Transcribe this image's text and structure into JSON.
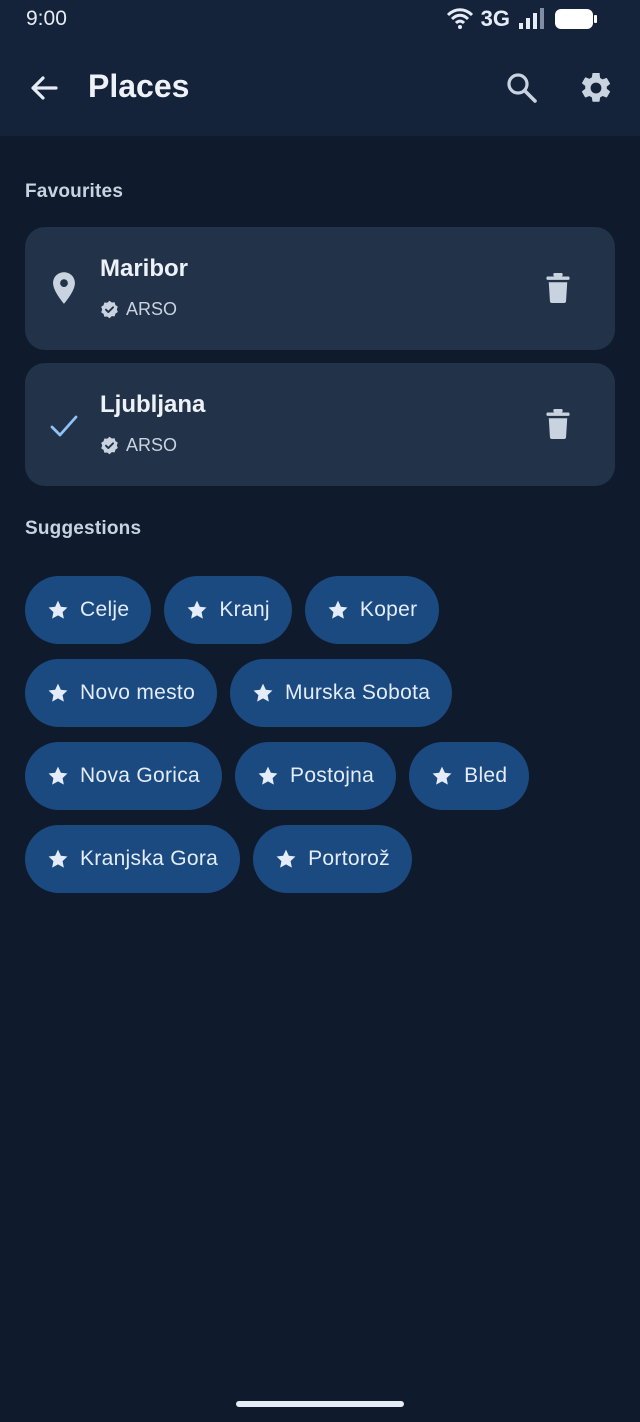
{
  "status_bar": {
    "time": "9:00",
    "network": "3G",
    "icons": [
      "wifi-icon",
      "signal-icon",
      "battery-icon"
    ]
  },
  "app_bar": {
    "title": "Places",
    "icons": [
      "back-arrow-icon",
      "search-icon",
      "gear-icon"
    ]
  },
  "favourites": {
    "title": "Favourites",
    "items": [
      {
        "name": "Maribor",
        "source": "ARSO",
        "lead_icon": "location-pin-icon"
      },
      {
        "name": "Ljubljana",
        "source": "ARSO",
        "lead_icon": "check-icon"
      }
    ]
  },
  "suggestions": {
    "title": "Suggestions",
    "rows": [
      [
        "Celje",
        "Kranj",
        "Koper"
      ],
      [
        "Novo mesto",
        "Murska Sobota"
      ],
      [
        "Nova Gorica",
        "Postojna",
        "Bled"
      ],
      [
        "Kranjska Gora",
        "Portorož"
      ]
    ]
  },
  "colors": {
    "background": "#0f1b2d",
    "app_bar": "#14233a",
    "card": "#223249",
    "chip": "#1b4a80",
    "accent_check": "#8fc3f5"
  }
}
